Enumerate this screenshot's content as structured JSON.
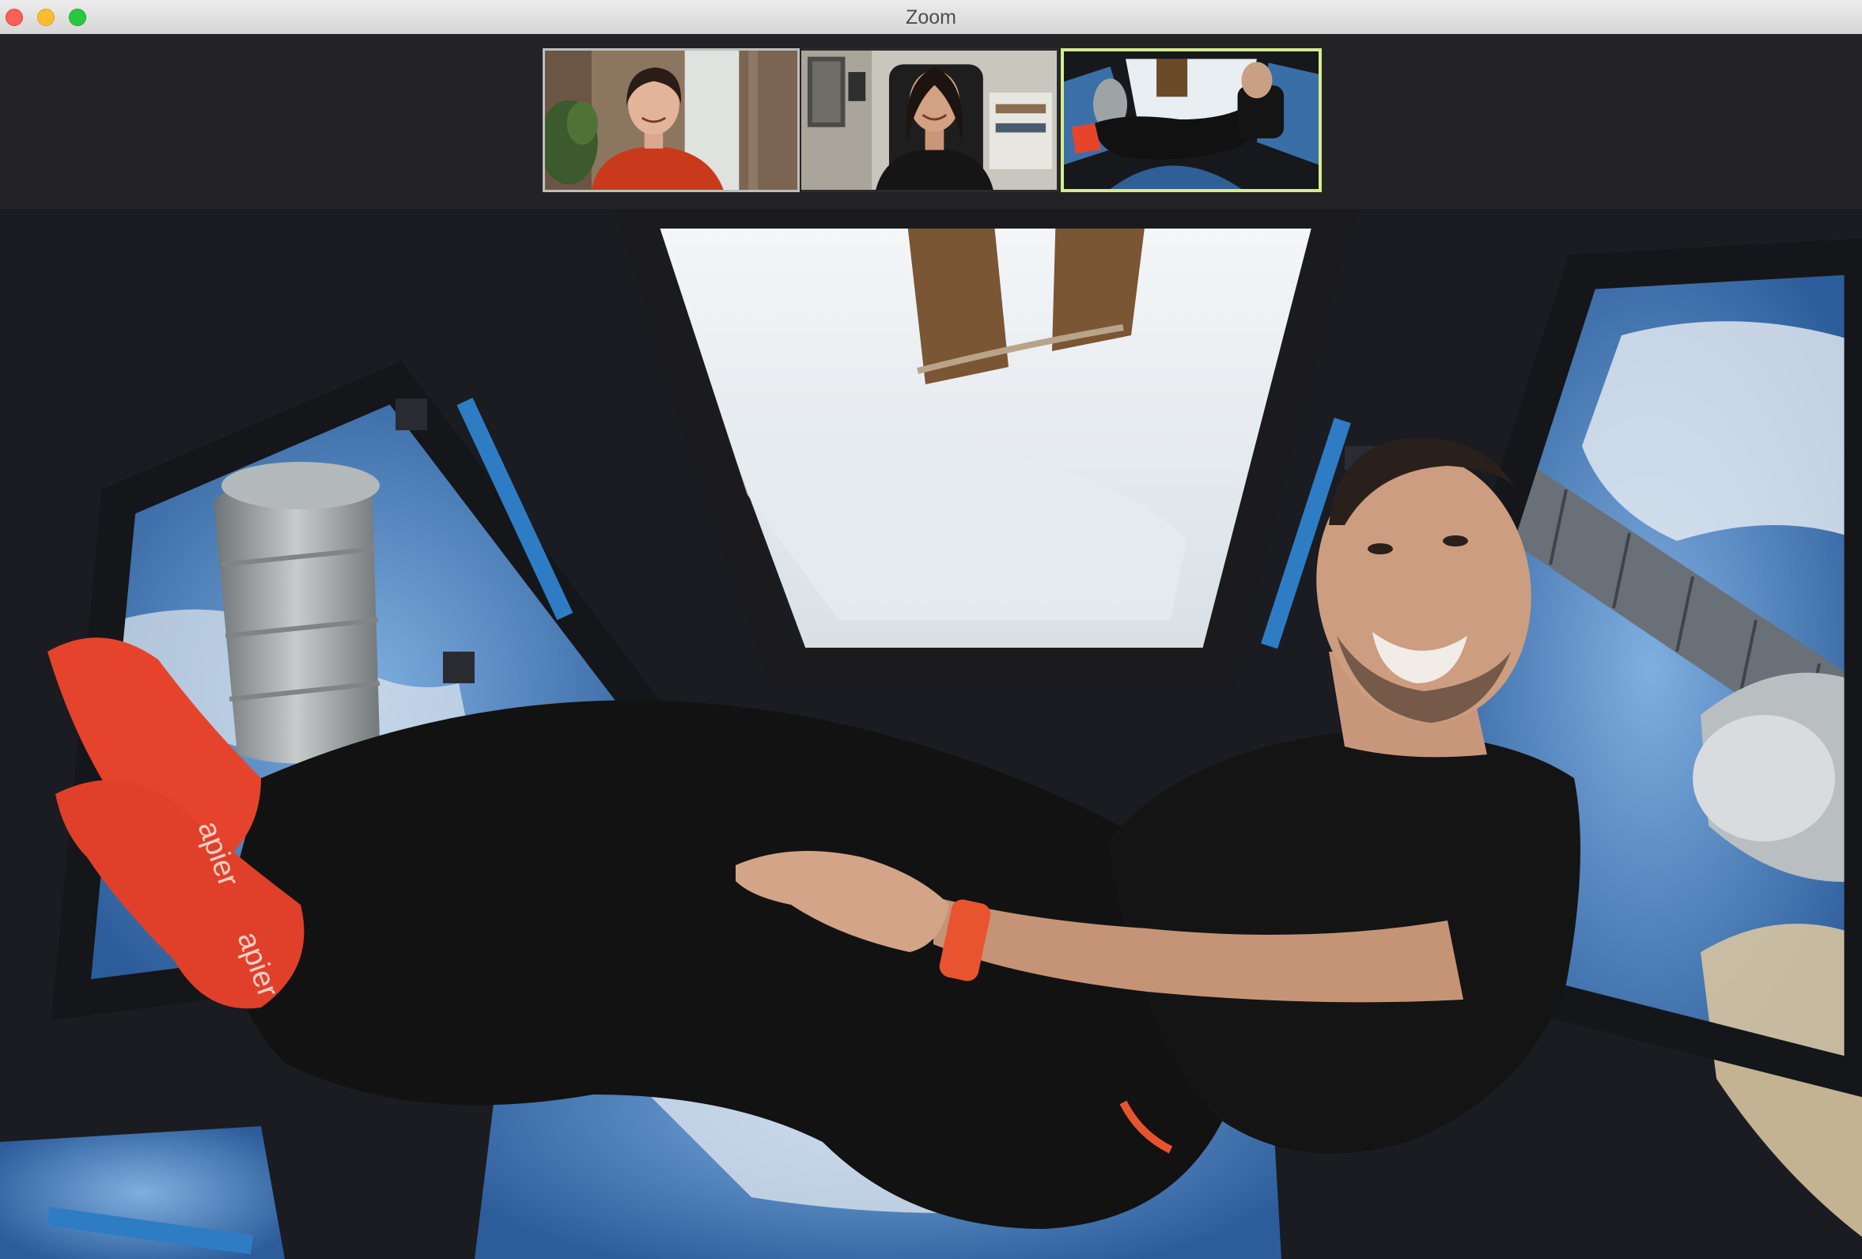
{
  "window": {
    "title": "Zoom",
    "controls": [
      "close",
      "minimize",
      "zoom"
    ]
  },
  "participants": [
    {
      "tile": "participant-video-1",
      "active_speaker": false,
      "shirt_color": "#c93a1c"
    },
    {
      "tile": "participant-video-2",
      "active_speaker": false,
      "shirt_color": "#151515"
    },
    {
      "tile": "participant-video-3",
      "active_speaker": true,
      "shirt_color": "#111111"
    }
  ],
  "colors": {
    "active_speaker_border": "#d5ec8c",
    "strip_background": "#232326",
    "close": "#fe5f57",
    "minimize": "#febc2e",
    "zoom": "#28c840"
  }
}
